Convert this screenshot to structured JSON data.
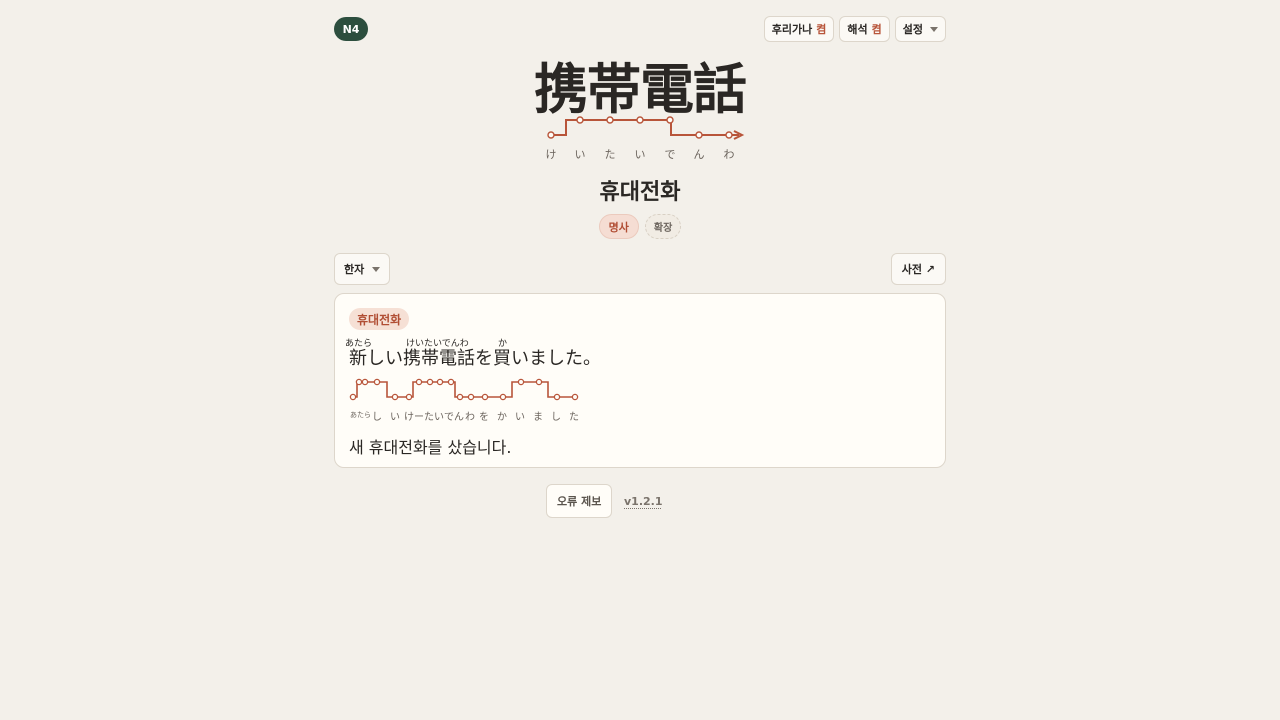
{
  "level": "N4",
  "toggles": [
    {
      "label": "후리가나",
      "state": "켬"
    },
    {
      "label": "해석",
      "state": "켬"
    }
  ],
  "settings_label": "설정",
  "word": {
    "kanji": "携帯電話",
    "kana": [
      "け",
      "い",
      "た",
      "い",
      "で",
      "ん",
      "わ"
    ],
    "korean": "휴대전화",
    "pos_tag": "명사",
    "expand_tag": "확장",
    "pitch_levels": [
      0,
      1,
      1,
      1,
      1,
      0,
      0
    ]
  },
  "script_select": "한자",
  "dictionary_link": "사전 ↗",
  "example": {
    "chip": "휴대전화",
    "sentence": "新しい携帯電話を買いました。",
    "ruby": [
      "あたら",
      "けいたいでんわ",
      "か"
    ],
    "kana": [
      "あたら",
      "し",
      "い",
      "け",
      "ー",
      "た",
      "い",
      "で",
      "ん",
      "わ",
      "を",
      "か",
      "い",
      "ま",
      "し",
      "た"
    ],
    "translation": "새 휴대전화를 샀습니다."
  },
  "footer": {
    "report": "오류 제보",
    "version": "v1.2.1"
  },
  "colors": {
    "accent": "#b8553a",
    "badge": "#2c4e3e",
    "background": "#f3f0ea"
  }
}
